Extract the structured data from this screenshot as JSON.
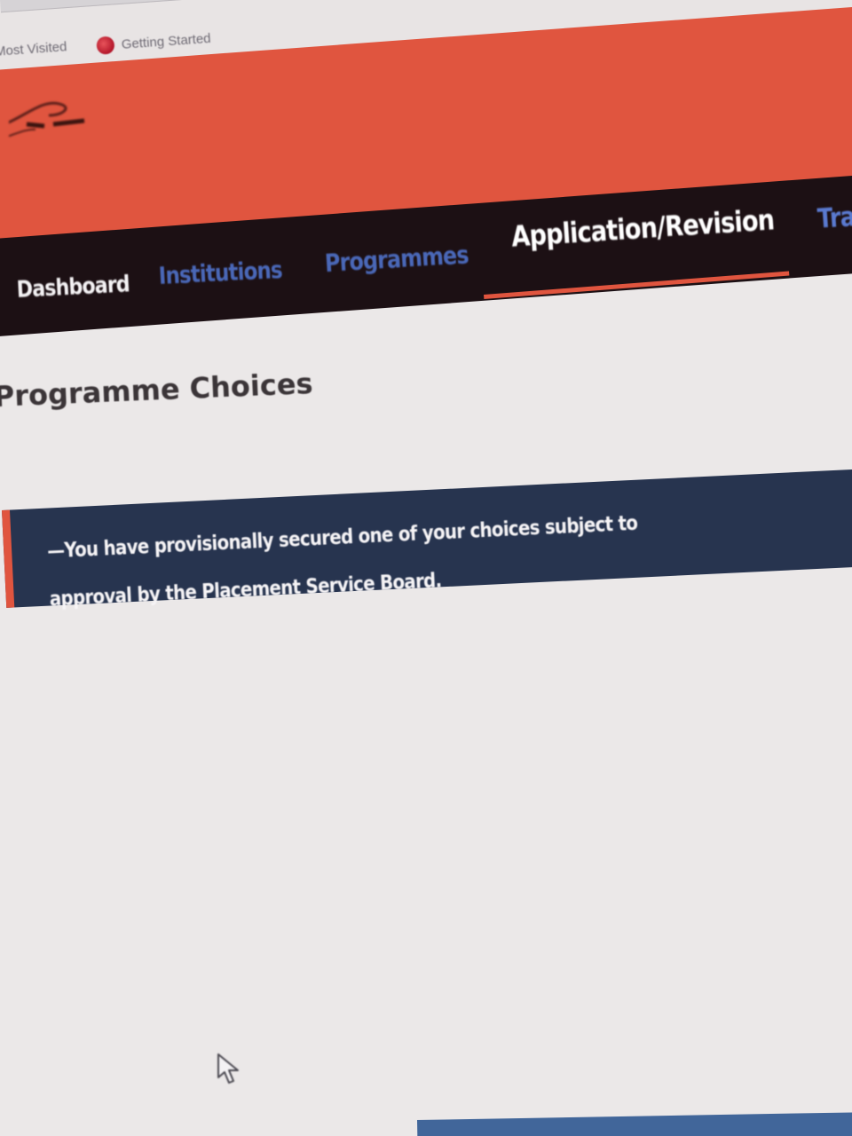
{
  "browser": {
    "bookmarks": [
      {
        "label": "Most Visited"
      },
      {
        "label": "Getting Started",
        "icon": "firefox-icon"
      }
    ]
  },
  "nav": {
    "items": [
      {
        "label": "Dashboard",
        "active": false,
        "color": "#f4f2f4"
      },
      {
        "label": "Institutions",
        "active": false,
        "color": "#4a68b8"
      },
      {
        "label": "Programmes",
        "active": false,
        "color": "#4a68b8"
      },
      {
        "label": "Application/Revision",
        "active": true,
        "color": "#ffffff"
      },
      {
        "label": "Tra",
        "active": false,
        "color": "#5a7ad0"
      }
    ]
  },
  "page": {
    "title": "Programme Choices"
  },
  "alert": {
    "message": "—You have provisionally secured one of your choices subject to approval by the Placement Service Board."
  },
  "colors": {
    "header_bg": "#e0553f",
    "nav_bg": "#1c1014",
    "alert_bg": "#27344f",
    "accent": "#e0553f",
    "page_bg": "#ebe8e8"
  }
}
